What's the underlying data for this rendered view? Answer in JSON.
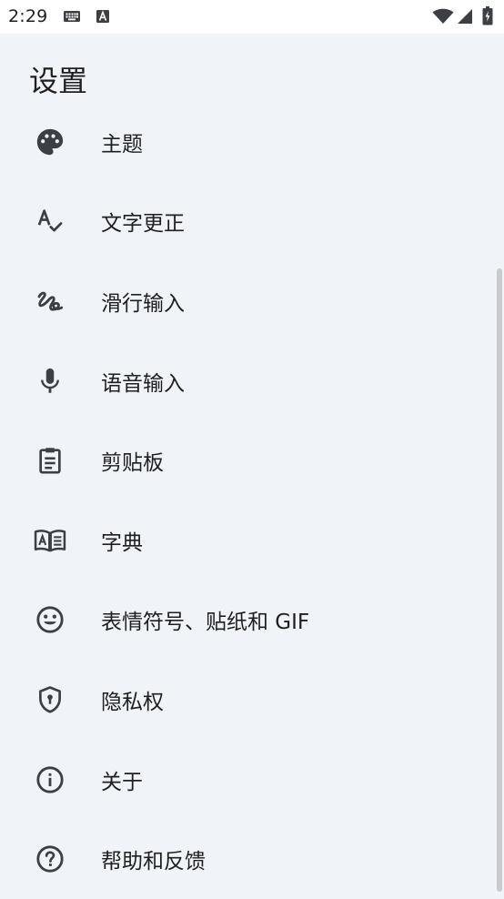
{
  "status_bar": {
    "time": "2:29",
    "icons": [
      "keyboard-icon",
      "a-notification-icon",
      "wifi-icon",
      "signal-icon",
      "battery-icon"
    ]
  },
  "title": "设置",
  "menu": [
    {
      "id": "theme",
      "label": "主题",
      "icon": "palette-icon"
    },
    {
      "id": "text-correction",
      "label": "文字更正",
      "icon": "spellcheck-icon"
    },
    {
      "id": "glide-typing",
      "label": "滑行输入",
      "icon": "gesture-icon"
    },
    {
      "id": "voice-input",
      "label": "语音输入",
      "icon": "mic-icon"
    },
    {
      "id": "clipboard",
      "label": "剪贴板",
      "icon": "clipboard-icon"
    },
    {
      "id": "dictionary",
      "label": "字典",
      "icon": "dictionary-icon"
    },
    {
      "id": "emoji",
      "label": "表情符号、贴纸和 GIF",
      "icon": "emoji-icon"
    },
    {
      "id": "privacy",
      "label": "隐私权",
      "icon": "privacy-shield-icon"
    },
    {
      "id": "about",
      "label": "关于",
      "icon": "info-icon"
    },
    {
      "id": "help",
      "label": "帮助和反馈",
      "icon": "help-icon"
    }
  ],
  "colors": {
    "background": "#f0f3f8",
    "icon": "#3c3f43",
    "text": "#1f1f1f"
  }
}
